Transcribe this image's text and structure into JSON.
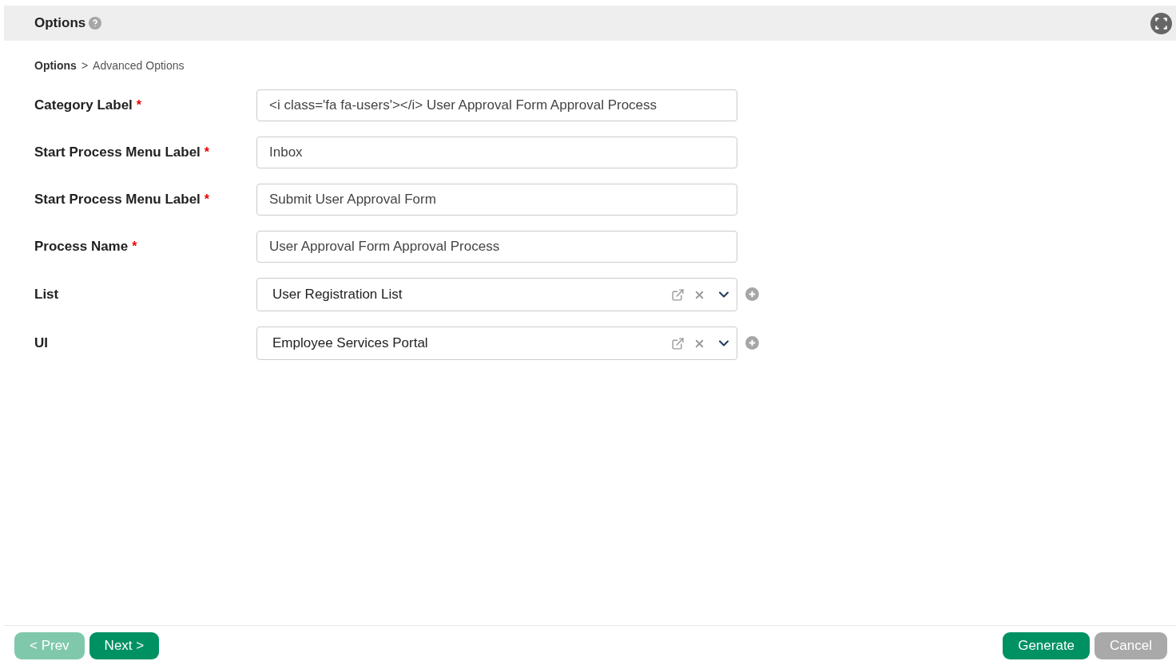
{
  "header": {
    "title": "Options"
  },
  "breadcrumb": [
    {
      "label": "Options",
      "current": false
    },
    {
      "label": "Advanced Options",
      "current": true
    }
  ],
  "breadcrumb_separator": ">",
  "fields": [
    {
      "kind": "text",
      "label": "Category Label",
      "required_mark": "*",
      "value": "<i class='fa fa-users'></i> User Approval Form Approval Process"
    },
    {
      "kind": "text",
      "label": "Start Process Menu Label",
      "required_mark": "*",
      "value": "Inbox"
    },
    {
      "kind": "text",
      "label": "Start Process Menu Label",
      "required_mark": "*",
      "value": "Submit User Approval Form"
    },
    {
      "kind": "text",
      "label": "Process Name",
      "required_mark": "*",
      "value": "User Approval Form Approval Process"
    },
    {
      "kind": "select",
      "label": "List",
      "value": "User Registration List"
    },
    {
      "kind": "select",
      "label": "UI",
      "value": "Employee Services Portal"
    }
  ],
  "footer_left": [
    {
      "label": "< Prev",
      "disabled": true
    },
    {
      "label": "Next >",
      "disabled": false
    }
  ],
  "footer_right": [
    {
      "label": "Generate",
      "kind": "primary"
    },
    {
      "label": "Cancel",
      "kind": "secondary"
    }
  ]
}
